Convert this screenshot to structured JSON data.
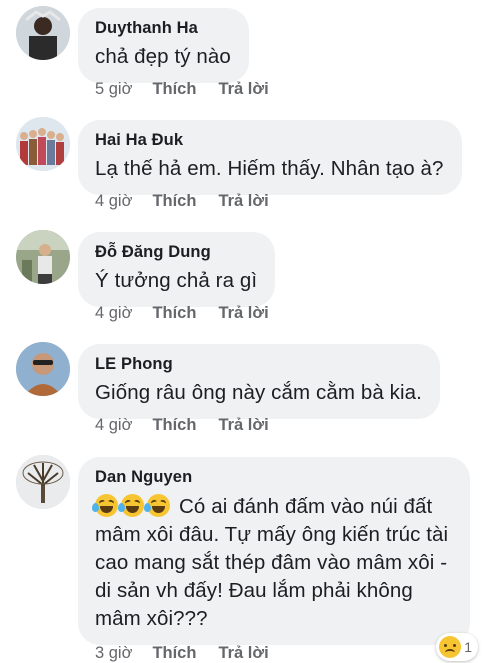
{
  "comments": [
    {
      "author": "Duythanh Ha",
      "text": "chả đẹp tý nào",
      "time": "5 giờ",
      "like": "Thích",
      "reply": "Trả lời",
      "avatar_icon": "avatar-photo"
    },
    {
      "author": "Hai Ha Đuk",
      "text": "Lạ thế hả em. Hiếm thấy. Nhân tạo à?",
      "time": "4 giờ",
      "like": "Thích",
      "reply": "Trả lời",
      "avatar_icon": "avatar-photo"
    },
    {
      "author": "Đỗ Đăng Dung",
      "text": "Ý tưởng chả ra gì",
      "time": "4 giờ",
      "like": "Thích",
      "reply": "Trả lời",
      "avatar_icon": "avatar-photo"
    },
    {
      "author": "LE Phong",
      "text": "Giống râu ông này cắm cằm bà kia.",
      "time": "4 giờ",
      "like": "Thích",
      "reply": "Trả lời",
      "avatar_icon": "avatar-photo"
    },
    {
      "author": "Dan Nguyen",
      "text_line1": "Có ai đánh đấm vào núi đất",
      "text_line2": "mâm xôi đâu. Tự mấy ông kiến trúc tài",
      "text_line3": "cao mang sắt thép đâm vào mâm xôi -",
      "text_line4": "di sản vh đấy! Đau lắm phải không",
      "text_line5": "mâm xôi???",
      "emoji_icon": "rofl-emoji",
      "time": "3 giờ",
      "like": "Thích",
      "reply": "Trả lời",
      "reaction_icon": "sad-reaction-icon",
      "reaction_count": "1",
      "avatar_icon": "avatar-photo"
    }
  ],
  "colors": {
    "bubble": "#eff1f3",
    "meta_text": "#65676b",
    "text": "#1c1e21"
  }
}
